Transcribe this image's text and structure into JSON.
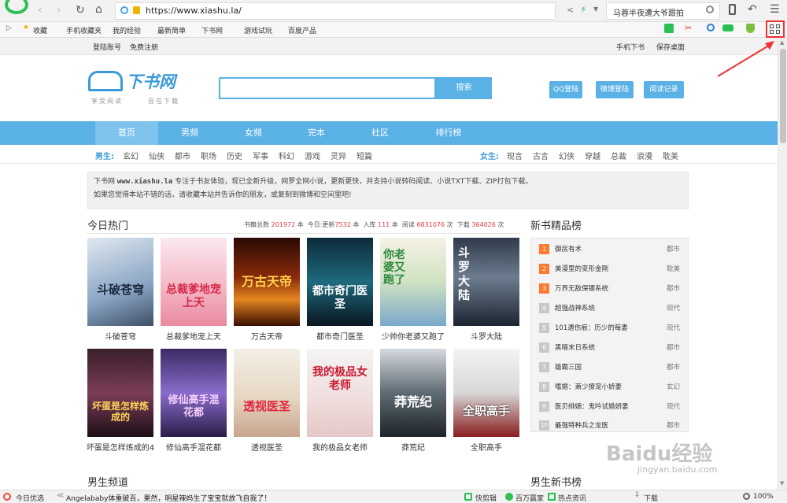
{
  "browser": {
    "url": "https://www.xiashu.la/",
    "search_text": "马蓉半夜遭大爷跟拍",
    "bookmarks": [
      "收藏",
      "手机收藏夹",
      "我的经验",
      "最新简单",
      "下书网",
      "游戏试玩",
      "百度产品"
    ]
  },
  "topbar": {
    "login": "登陆账号",
    "register": "免费注册",
    "mobile": "手机下书",
    "save_desktop": "保存桌面"
  },
  "logo": {
    "title": "下书网",
    "slogan_left": "享受阅读",
    "slogan_right": "自在下载"
  },
  "search": {
    "placeholder": "",
    "button": "搜索"
  },
  "auth": {
    "qq": "QQ登陆",
    "weibo": "微博登陆",
    "history": "阅读记录"
  },
  "nav": [
    "首页",
    "男频",
    "女频",
    "完本",
    "社区",
    "排行榜"
  ],
  "categories": {
    "male_label": "男生:",
    "male": [
      "玄幻",
      "仙侠",
      "都市",
      "职场",
      "历史",
      "军事",
      "科幻",
      "游戏",
      "灵异",
      "短篇"
    ],
    "female_label": "女生:",
    "female": [
      "现言",
      "古言",
      "幻侠",
      "穿越",
      "总裁",
      "浪漫",
      "耽美"
    ]
  },
  "notice": {
    "line1_prefix": "下书网 ",
    "line1_site": "www.xiashu.la",
    "line1_text": " 专注于书友体验，现已全新升级，网罗全网小说，更新更快，并支持小说转码阅读、小说TXT下载、ZIP打包下载。",
    "line2": "如果您觉得本站不错的话，请收藏本站并告诉你的朋友，或复制到微博和空间里吧!"
  },
  "hot": {
    "title": "今日热门",
    "stats": [
      {
        "label": "书籍总数",
        "value": "201972",
        "unit": "本"
      },
      {
        "label": "今日:更新",
        "value": "7532",
        "unit": "本"
      },
      {
        "label": "入库",
        "value": "111",
        "unit": "本"
      },
      {
        "label": "阅读",
        "value": "6831076",
        "unit": "次"
      },
      {
        "label": "下载",
        "value": "364026",
        "unit": "次"
      }
    ],
    "books": [
      {
        "name": "斗破苍穹",
        "cover_text": "斗破苍穹"
      },
      {
        "name": "总裁爹地宠上天",
        "cover_text": "总裁爹地宠上天"
      },
      {
        "name": "万古天帝",
        "cover_text": "万古天帝"
      },
      {
        "name": "都市奇门医圣",
        "cover_text": "都市奇门医圣"
      },
      {
        "name": "少帅你老婆又跑了",
        "cover_text": "你老婆又跑了"
      },
      {
        "name": "斗罗大陆",
        "cover_text": "斗罗大陆"
      },
      {
        "name": "坏蛋是怎样炼成的4",
        "cover_text": "坏蛋是怎样炼成的"
      },
      {
        "name": "修仙高手混花都",
        "cover_text": "修仙高手混花都"
      },
      {
        "name": "透视医圣",
        "cover_text": "透视医圣"
      },
      {
        "name": "我的极品女老师",
        "cover_text": "我的极品女老师"
      },
      {
        "name": "莽荒纪",
        "cover_text": "莽荒纪"
      },
      {
        "name": "全职高手",
        "cover_text": "全职高手"
      }
    ]
  },
  "ranking": {
    "title": "新书精品榜",
    "items": [
      {
        "num": "1",
        "title": "御房有术",
        "cat": "都市"
      },
      {
        "num": "2",
        "title": "美漫里的变形金刚",
        "cat": "耽美"
      },
      {
        "num": "3",
        "title": "万界无敌保镖系统",
        "cat": "都市"
      },
      {
        "num": "4",
        "title": "超强战神系统",
        "cat": "现代"
      },
      {
        "num": "5",
        "title": "101遇伤痕：历少的莓妻",
        "cat": "现代"
      },
      {
        "num": "6",
        "title": "黑暗末日系统",
        "cat": "都市"
      },
      {
        "num": "7",
        "title": "雄霸三国",
        "cat": "都市"
      },
      {
        "num": "8",
        "title": "嗜婚：萧少撩宠小娇妻",
        "cat": "玄幻"
      },
      {
        "num": "9",
        "title": "医贝绯嫡：鬼吟试婚娇妻",
        "cat": "现代"
      },
      {
        "num": "10",
        "title": "最强特种兵之龙医",
        "cat": "都市"
      }
    ]
  },
  "sections": {
    "male_channel": "男生频道",
    "male_new": "男生新书榜"
  },
  "status": {
    "left": "今日优选",
    "news": "Angelababy体重破百，果然，明星辣妈生了宝宝就放飞自我了！",
    "quick": "快剪辑",
    "million": "百万赢家",
    "hot": "热点资讯",
    "download": "下载",
    "zoom": "100%"
  },
  "watermark": {
    "brand": "Baidu经验",
    "url": "jingyan.baidu.com"
  },
  "colors": {
    "accent": "#5ab1e5",
    "nav_bg": "#5ab1e5",
    "rank_orange": "#ff7a2f",
    "rank_gray": "#c8c8c8",
    "stat_red": "#e4393c"
  }
}
